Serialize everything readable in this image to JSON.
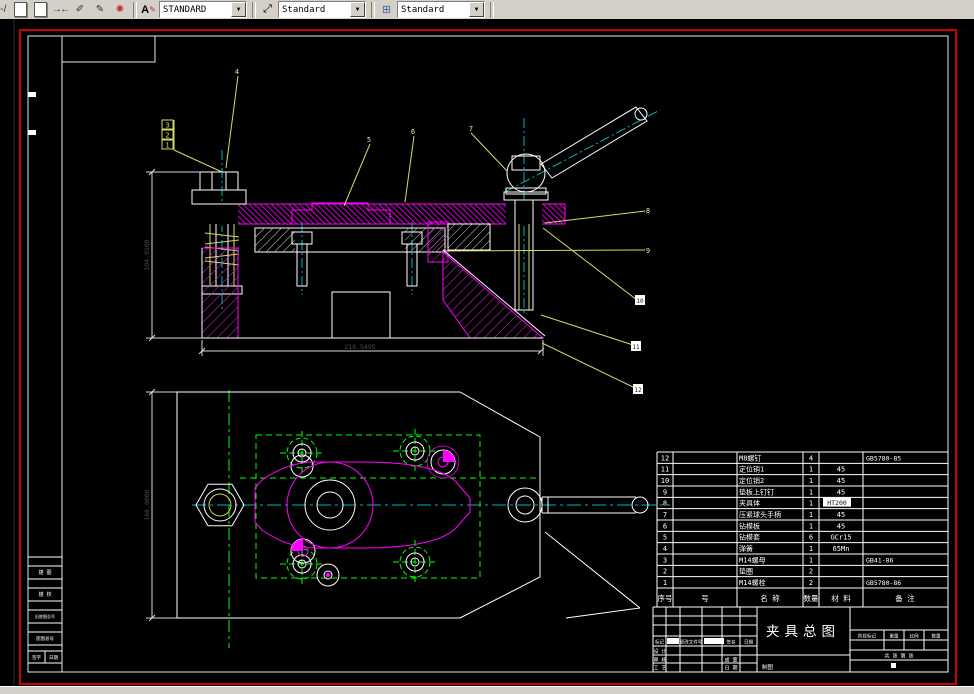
{
  "toolbar": {
    "text_style_label": "STANDARD",
    "dim_style_label": "Standard",
    "table_style_label": "Standard",
    "dropdown_arrow": "▼"
  },
  "drawing": {
    "title": "夹具总图",
    "dimensions": {
      "section_height": "104.9100",
      "section_length": "219.5495",
      "plan_height": "166.0000"
    },
    "leaders": {
      "stack": [
        "3",
        "2",
        "1"
      ],
      "top": [
        "4",
        "5",
        "6",
        "7"
      ],
      "right_plain": [
        "8",
        "9"
      ],
      "right_boxed": [
        "10",
        "11",
        "12"
      ]
    },
    "colors": {
      "part_magenta": "#ff00ff",
      "hidden_green": "#00ff00",
      "centerline_cyan": "#00b8b8",
      "leader_yellow": "#d8d86a",
      "outline_white": "#ffffff",
      "dim_text_gray": "#4a4a4a",
      "sheet_border_red": "#cf0000"
    }
  },
  "bom": {
    "headers": [
      "序号",
      "号",
      "名  称",
      "数量",
      "材 料",
      "备  注"
    ],
    "rows": [
      {
        "no": "12",
        "code": "",
        "name": "M8螺钉",
        "qty": "4",
        "mat": "",
        "note": "GB5780-85"
      },
      {
        "no": "11",
        "code": "",
        "name": "定位销1",
        "qty": "1",
        "mat": "45",
        "note": ""
      },
      {
        "no": "10",
        "code": "",
        "name": "定位销2",
        "qty": "1",
        "mat": "45",
        "note": ""
      },
      {
        "no": "9",
        "code": "",
        "name": "垫板上钉钉",
        "qty": "1",
        "mat": "45",
        "note": ""
      },
      {
        "no": "8",
        "code": "",
        "name": "夹具体",
        "qty": "1",
        "mat": "HT200",
        "note": ""
      },
      {
        "no": "7",
        "code": "",
        "name": "压紧球头手柄",
        "qty": "1",
        "mat": "45",
        "note": ""
      },
      {
        "no": "6",
        "code": "",
        "name": "钻模板",
        "qty": "1",
        "mat": "45",
        "note": ""
      },
      {
        "no": "5",
        "code": "",
        "name": "钻模套",
        "qty": "6",
        "mat": "GCr15",
        "note": ""
      },
      {
        "no": "4",
        "code": "",
        "name": "弹簧",
        "qty": "1",
        "mat": "65Mn",
        "note": ""
      },
      {
        "no": "3",
        "code": "",
        "name": "M14螺母",
        "qty": "1",
        "mat": "",
        "note": "GB41-86"
      },
      {
        "no": "2",
        "code": "",
        "name": "垫圈",
        "qty": "2",
        "mat": "",
        "note": ""
      },
      {
        "no": "1",
        "code": "",
        "name": "M14螺栓",
        "qty": "2",
        "mat": "",
        "note": "GB5780-86"
      }
    ]
  },
  "title_block": {
    "title": "夹具总图",
    "header_cells": [
      "标记",
      "处数",
      "更改文件号",
      "签名",
      "日期"
    ],
    "left_rows": [
      [
        "设 计",
        ""
      ],
      [
        "审 核",
        "成 量"
      ],
      [
        "工 艺",
        "日 期"
      ]
    ],
    "bottom_left": "制图",
    "right_header": [
      "阶段标记",
      "重量",
      "比例",
      "数量"
    ],
    "sheet_row": "共  张  第  张"
  },
  "margin_strip": {
    "rows": [
      "描 图",
      "描 校",
      "旧底图总号",
      "底图总号"
    ],
    "sign_cells": [
      "签字",
      "日期"
    ]
  }
}
